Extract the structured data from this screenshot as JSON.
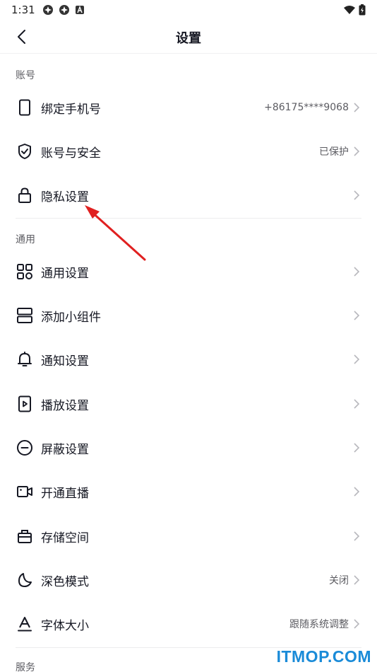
{
  "status_bar": {
    "time": "1:31",
    "left_icons": [
      "app-notification-icon",
      "app-notification-icon",
      "text-notification-icon"
    ],
    "right_icons": [
      "wifi-icon",
      "battery-icon"
    ]
  },
  "nav": {
    "title": "设置",
    "back_icon": "chevron-left-icon"
  },
  "sections": {
    "account": {
      "header": "账号",
      "items": [
        {
          "label": "绑定手机号",
          "value": "+86175****9068",
          "icon": "phone-icon"
        },
        {
          "label": "账号与安全",
          "value": "已保护",
          "icon": "shield-check-icon"
        },
        {
          "label": "隐私设置",
          "value": "",
          "icon": "lock-icon"
        }
      ]
    },
    "general": {
      "header": "通用",
      "items": [
        {
          "label": "通用设置",
          "value": "",
          "icon": "grid-icon"
        },
        {
          "label": "添加小组件",
          "value": "",
          "icon": "widget-icon"
        },
        {
          "label": "通知设置",
          "value": "",
          "icon": "bell-icon"
        },
        {
          "label": "播放设置",
          "value": "",
          "icon": "play-icon"
        },
        {
          "label": "屏蔽设置",
          "value": "",
          "icon": "block-icon"
        },
        {
          "label": "开通直播",
          "value": "",
          "icon": "video-camera-icon"
        },
        {
          "label": "存储空间",
          "value": "",
          "icon": "storage-icon"
        },
        {
          "label": "深色模式",
          "value": "关闭",
          "icon": "moon-icon"
        },
        {
          "label": "字体大小",
          "value": "跟随系统调整",
          "icon": "font-size-icon"
        }
      ]
    },
    "service": {
      "header": "服务"
    }
  },
  "watermark": {
    "text": "ITMOP.COM",
    "color": "#1a8bd8"
  },
  "colors": {
    "primary_text": "#161823",
    "secondary_text": "#5c5c62",
    "annotation_arrow": "#e02020"
  }
}
